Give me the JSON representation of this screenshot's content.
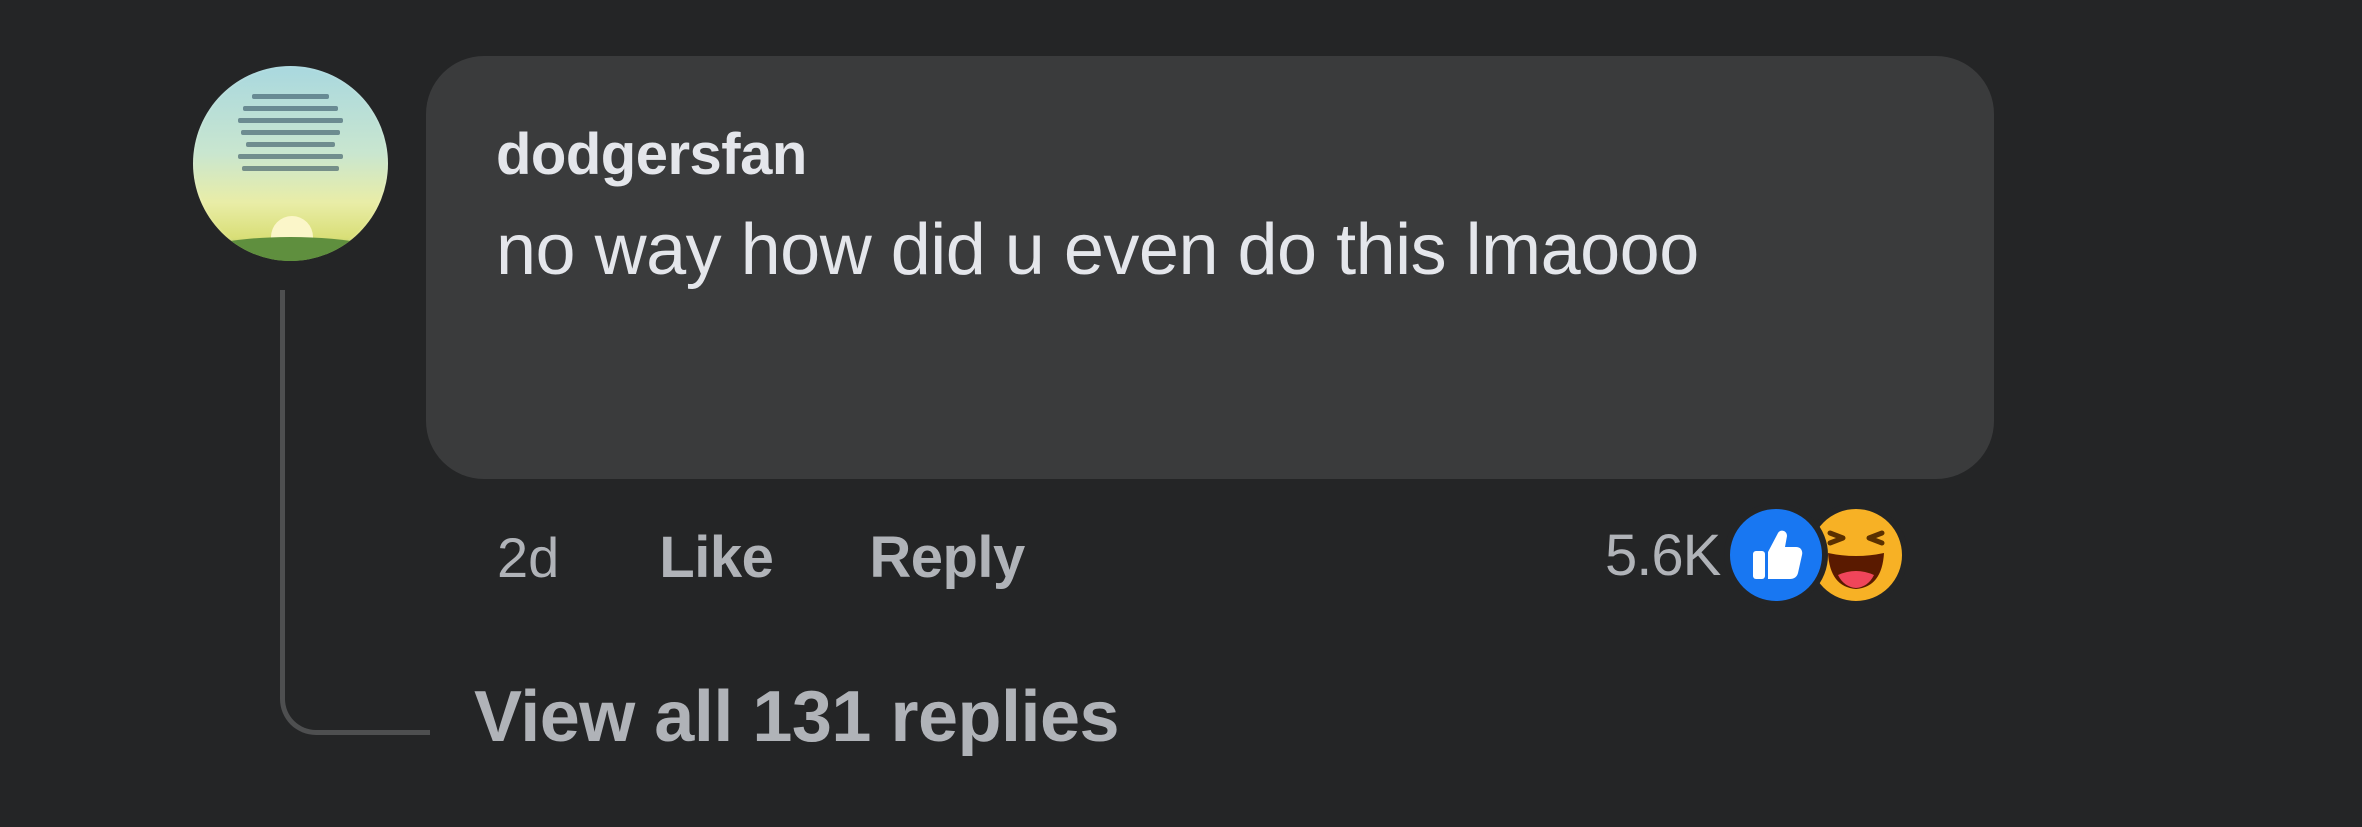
{
  "comment": {
    "author": "dodgersfan",
    "text": "no way how did u even do this lmaooo",
    "timestamp": "2d",
    "like_label": "Like",
    "reply_label": "Reply",
    "reaction_count": "5.6K",
    "reaction_icons": [
      "like-icon",
      "haha-icon"
    ],
    "view_replies_label": "View all 131 replies"
  },
  "colors": {
    "background": "#242526",
    "bubble": "#3a3b3c",
    "primary_text": "#e4e6eb",
    "secondary_text": "#b0b3b8",
    "like_blue": "#1877f2",
    "haha_yellow": "#f7b125"
  }
}
